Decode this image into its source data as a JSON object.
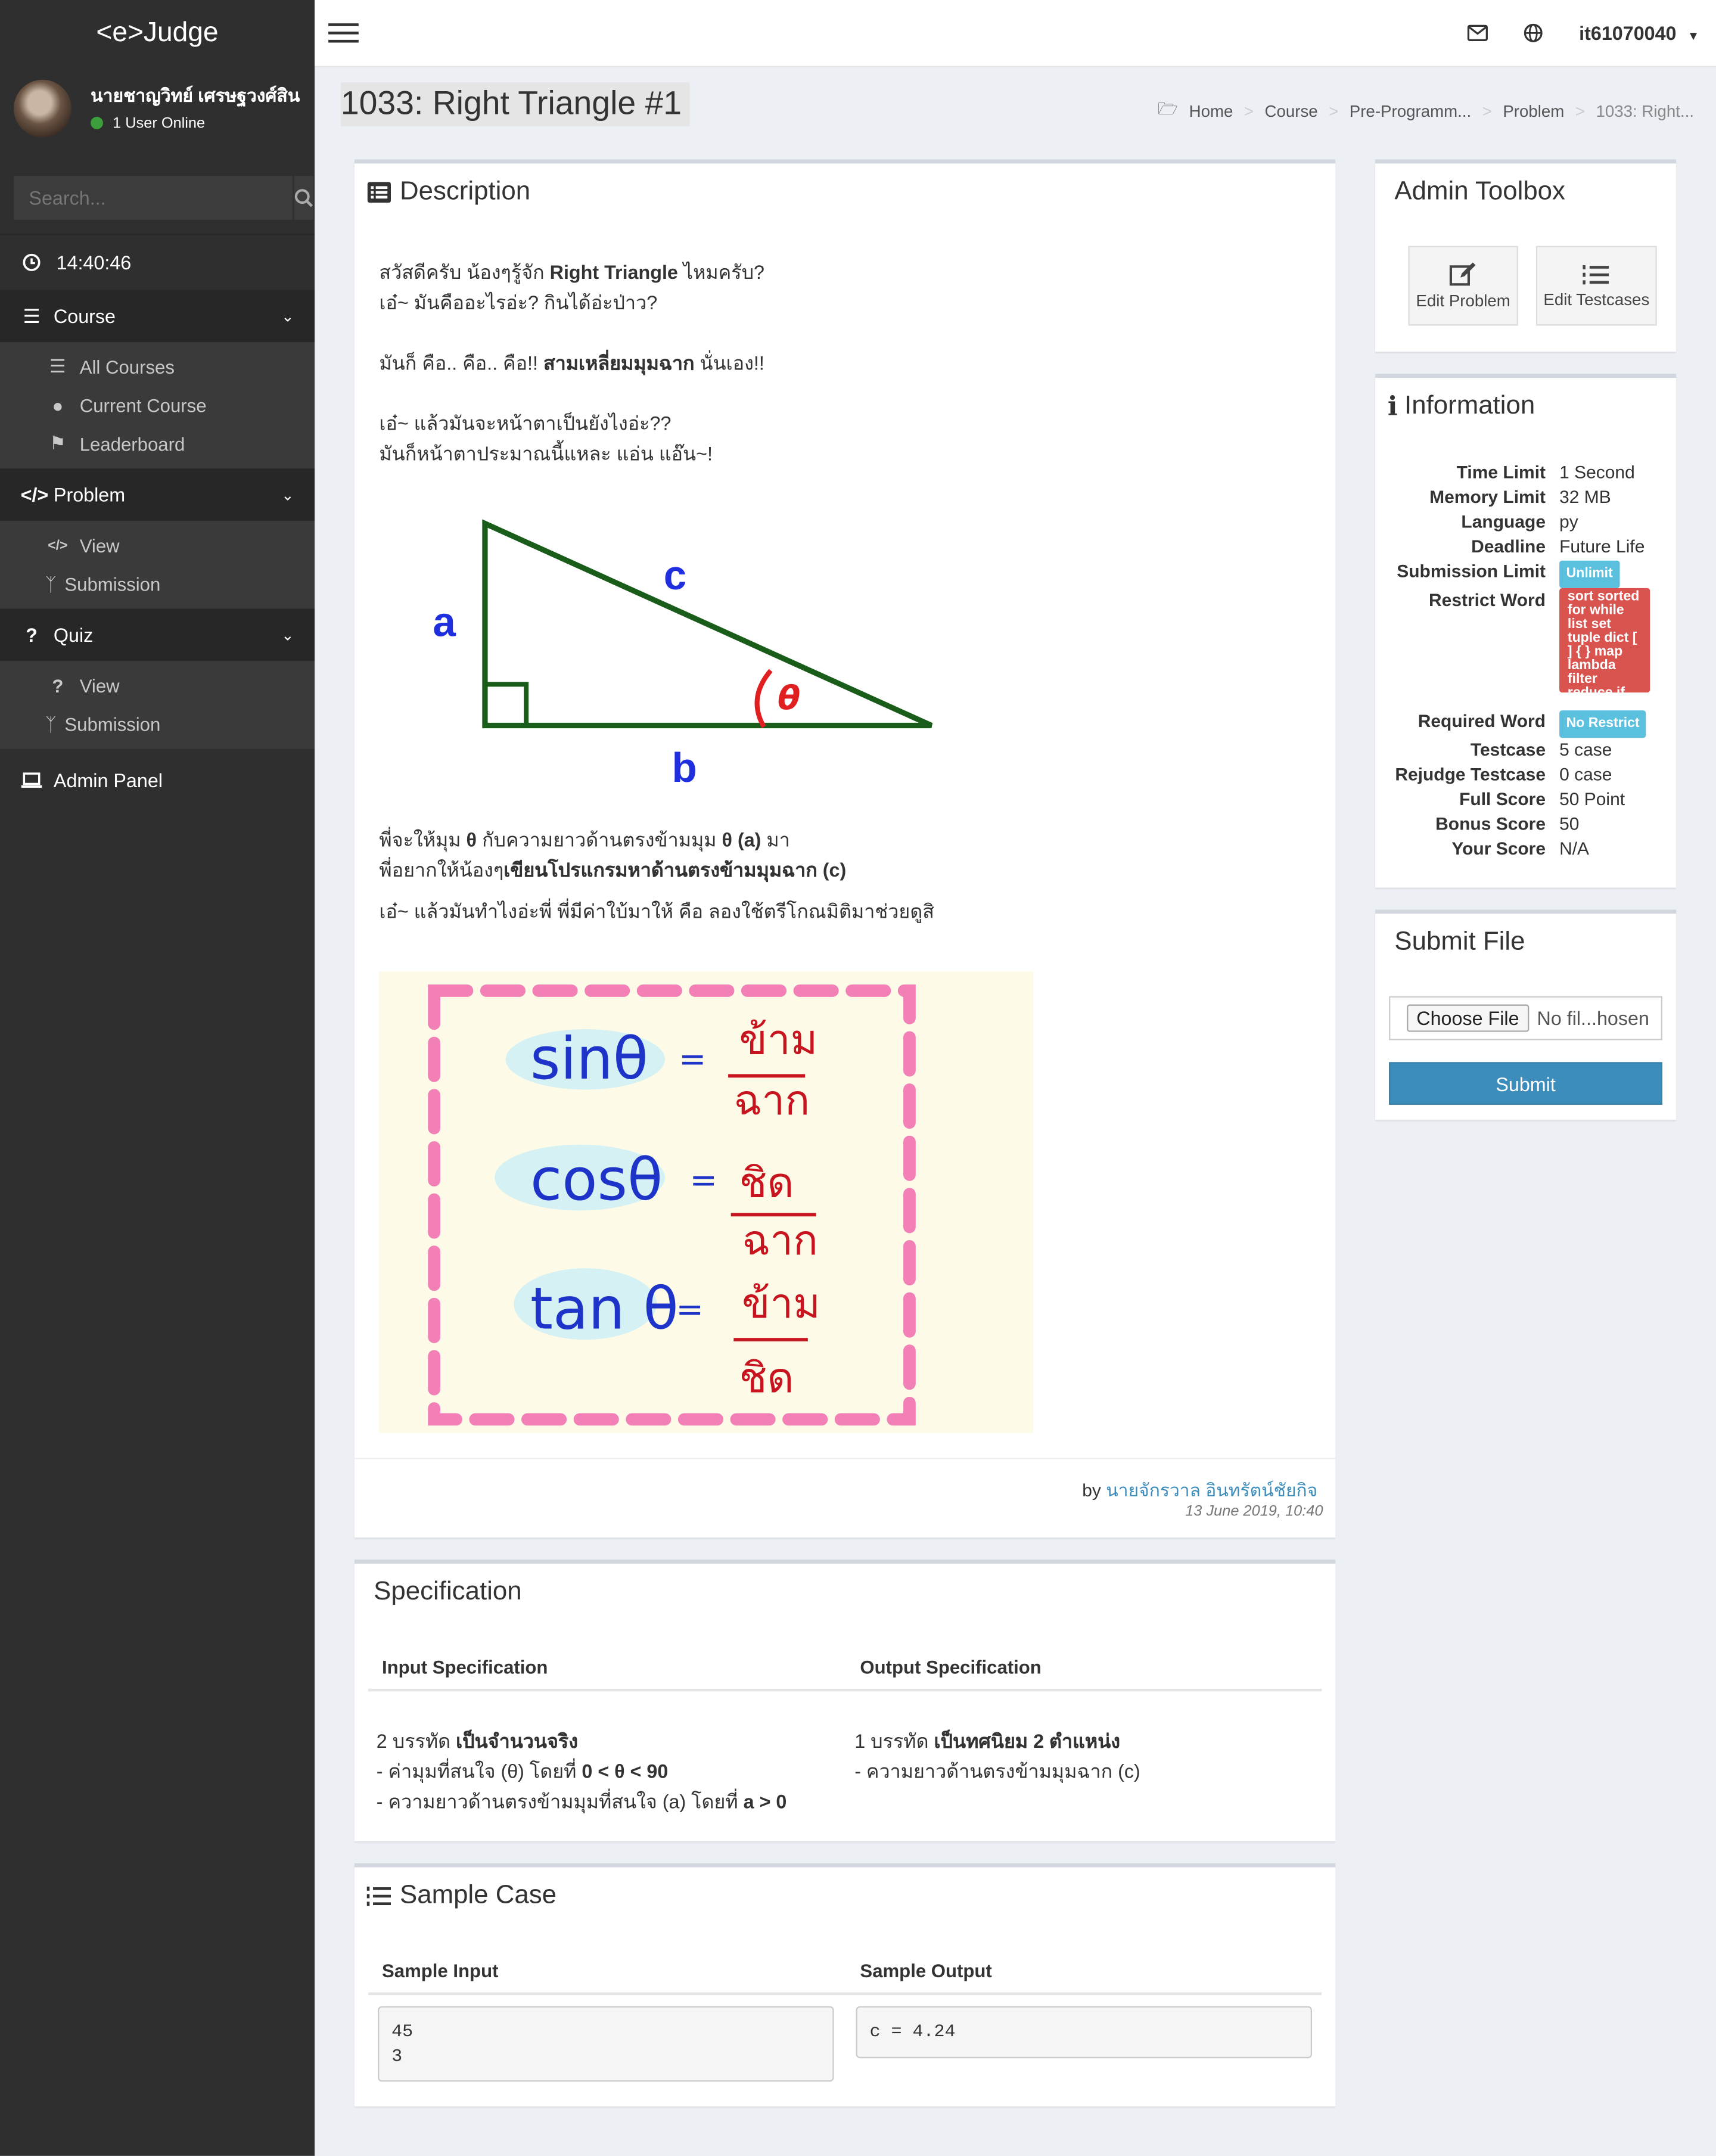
{
  "app": {
    "brand": "<e>Judge"
  },
  "user": {
    "name": "นายชาญวิทย์ เศรษฐวงศ์สิน",
    "status": "1 User Online"
  },
  "search": {
    "placeholder": "Search..."
  },
  "clock": "14:40:46",
  "sidebar": {
    "course": {
      "label": "Course",
      "items": [
        "All Courses",
        "Current Course",
        "Leaderboard"
      ]
    },
    "problem": {
      "label": "Problem",
      "items": [
        "View",
        "Submission"
      ]
    },
    "quiz": {
      "label": "Quiz",
      "items": [
        "View",
        "Submission"
      ]
    },
    "admin": "Admin Panel"
  },
  "topbar": {
    "username": "it61070040"
  },
  "page": {
    "title": "1033: Right Triangle #1"
  },
  "breadcrumb": [
    "Home",
    "Course",
    "Pre-Programm...",
    "Problem",
    "1033: Right..."
  ],
  "description": {
    "title": "Description",
    "line1_pre": "สวัสดีครับ น้องๆรู้จัก ",
    "line1_bold": "Right Triangle",
    "line1_post": " ไหมครับ?",
    "line2": "เอ๋~ มันคืออะไรอ่ะ?  กินได้อ่ะป่าว?",
    "line3_pre": "มันก็  คือ.. คือ.. คือ!! ",
    "line3_bold": "สามเหลี่ยมมุมฉาก",
    "line3_post": " นั่นเอง!!",
    "line4": "เอ๋~ แล้วมันจะหน้าตาเป็นยังไงอ่ะ??",
    "line5": "มันก็หน้าตาประมาณนี้แหละ แอ่น แอ๊น~!",
    "triangle_labels": {
      "a": "a",
      "b": "b",
      "c": "c",
      "theta": "θ"
    },
    "line6_pre": "พี่จะให้มุม ",
    "line6_bold1": "θ",
    "line6_mid": " กับความยาวด้านตรงข้ามมุม ",
    "line6_bold2": "θ (a)",
    "line6_post": " มา",
    "line7_pre": "พี่อยากให้น้องๆ",
    "line7_bold": "เขียนโปรแกรมหาด้านตรงข้ามมุมฉาก (c)",
    "line8": "เอ๋~ แล้วมันทำไงอ่ะพี่ พี่มีค่าใบ้มาให้ คือ ลองใช้ตรีโกณมิติมาช่วยดูสิ",
    "trig": {
      "sin": "sinθ",
      "cos": "cosθ",
      "tan": "tan θ",
      "eq": "=",
      "opp": "ข้าม",
      "hyp": "ฉาก",
      "adj": "ชิด"
    },
    "author_prefix": "by ",
    "author": "นายจักรวาล อินทรัตน์ชัยกิจ",
    "date": "13 June 2019, 10:40"
  },
  "specification": {
    "title": "Specification",
    "input_header": "Input Specification",
    "output_header": "Output Specification",
    "input_l1_pre": "2 บรรทัด ",
    "input_l1_bold": "เป็นจำนวนจริง",
    "input_l2_pre": " - ค่ามุมที่สนใจ (θ) โดยที่ ",
    "input_l2_bold": "0 < θ < 90",
    "input_l3_pre": " - ความยาวด้านตรงข้ามมุมที่สนใจ (a) โดยที่ ",
    "input_l3_bold": "a > 0",
    "output_l1_pre": "1 บรรทัด ",
    "output_l1_bold": "เป็นทศนิยม 2 ตำแหน่ง",
    "output_l2": " - ความยาวด้านตรงข้ามมุมฉาก (c)"
  },
  "sample": {
    "title": "Sample Case",
    "input_header": "Sample Input",
    "output_header": "Sample Output",
    "input": "45\n3",
    "output": "c = 4.24"
  },
  "toolbox": {
    "title": "Admin Toolbox",
    "edit_problem": "Edit Problem",
    "edit_testcases": "Edit Testcases"
  },
  "information": {
    "title": "Information",
    "rows": [
      {
        "k": "Time Limit",
        "v": "1 Second"
      },
      {
        "k": "Memory Limit",
        "v": "32 MB"
      },
      {
        "k": "Language",
        "v": "py"
      },
      {
        "k": "Deadline",
        "v": "Future Life"
      }
    ],
    "submission_limit_label": "Submission Limit",
    "submission_limit_value": "Unlimit",
    "restrict_word_label": "Restrict Word",
    "restrict_word_value": "sort sorted for while list set tuple dict [ ] { } map lambda filter reduce if",
    "required_word_label": "Required Word",
    "required_word_value": "No Restrict",
    "rows2": [
      {
        "k": "Testcase",
        "v": "5 case"
      },
      {
        "k": "Rejudge Testcase",
        "v": "0 case"
      },
      {
        "k": "Full Score",
        "v": "50 Point"
      },
      {
        "k": "Bonus Score",
        "v": "50"
      },
      {
        "k": "Your Score",
        "v": "N/A"
      }
    ]
  },
  "submit": {
    "title": "Submit File",
    "choose": "Choose File",
    "no_file": "No fil...hosen",
    "button": "Submit"
  },
  "colors": {
    "primary": "#3c8dbc",
    "sidebar": "#2f2f2f",
    "danger": "#d9534f",
    "info": "#5bc0de"
  }
}
